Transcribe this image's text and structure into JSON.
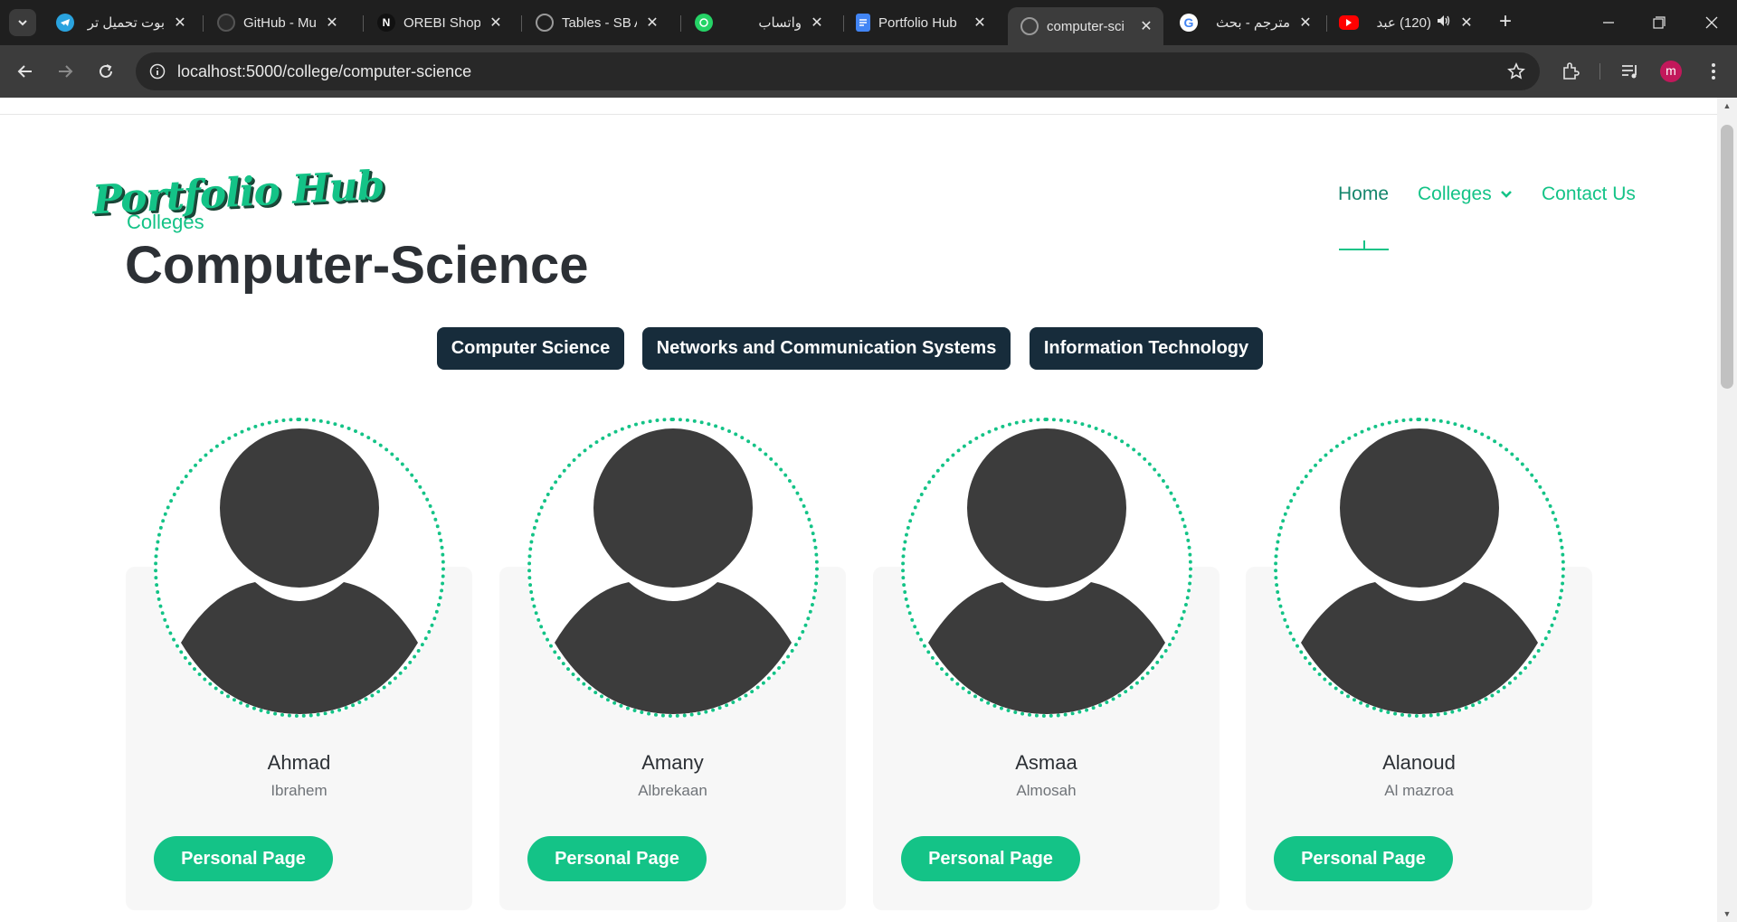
{
  "browser": {
    "tabs": [
      {
        "title": "بوت تحميل تر",
        "icon": "telegram-icon",
        "rtl": true
      },
      {
        "title": "GitHub - Mul",
        "icon": "github-icon",
        "rtl": false
      },
      {
        "title": "OREBI Shopp",
        "icon": "notion-icon",
        "rtl": false
      },
      {
        "title": "Tables - SB A",
        "icon": "globe-icon",
        "rtl": false
      },
      {
        "title": "واتساب",
        "icon": "whatsapp-icon",
        "rtl": true
      },
      {
        "title": "Portfolio Hub",
        "icon": "docs-icon",
        "rtl": false
      },
      {
        "title": "computer-sci",
        "icon": "globe-icon",
        "rtl": false,
        "active": true
      },
      {
        "title": "مترجم - بحث",
        "icon": "google-icon",
        "rtl": true
      },
      {
        "title": "(120) عبد",
        "icon": "youtube-icon",
        "rtl": true,
        "audio": true
      }
    ],
    "url": "localhost:5000/college/computer-science",
    "profile_initial": "m",
    "colors": {
      "accent": "#14c387",
      "chrome_dark": "#1f1f1f",
      "toolbar": "#3c3c3c"
    }
  },
  "site": {
    "logo": "Portfolio Hub",
    "nav": {
      "home": "Home",
      "colleges": "Colleges",
      "contact": "Contact Us"
    }
  },
  "page": {
    "eyebrow": "Colleges",
    "title": "Computer-Science",
    "departments": [
      "Computer Science",
      "Networks and Communication Systems",
      "Information Technology"
    ]
  },
  "students": [
    {
      "first": "Ahmad",
      "last": "Ibrahem",
      "button": "Personal Page"
    },
    {
      "first": "Amany",
      "last": "Albrekaan",
      "button": "Personal Page"
    },
    {
      "first": "Asmaa",
      "last": "Almosah",
      "button": "Personal Page"
    },
    {
      "first": "Alanoud",
      "last": "Al mazroa",
      "button": "Personal Page"
    }
  ]
}
